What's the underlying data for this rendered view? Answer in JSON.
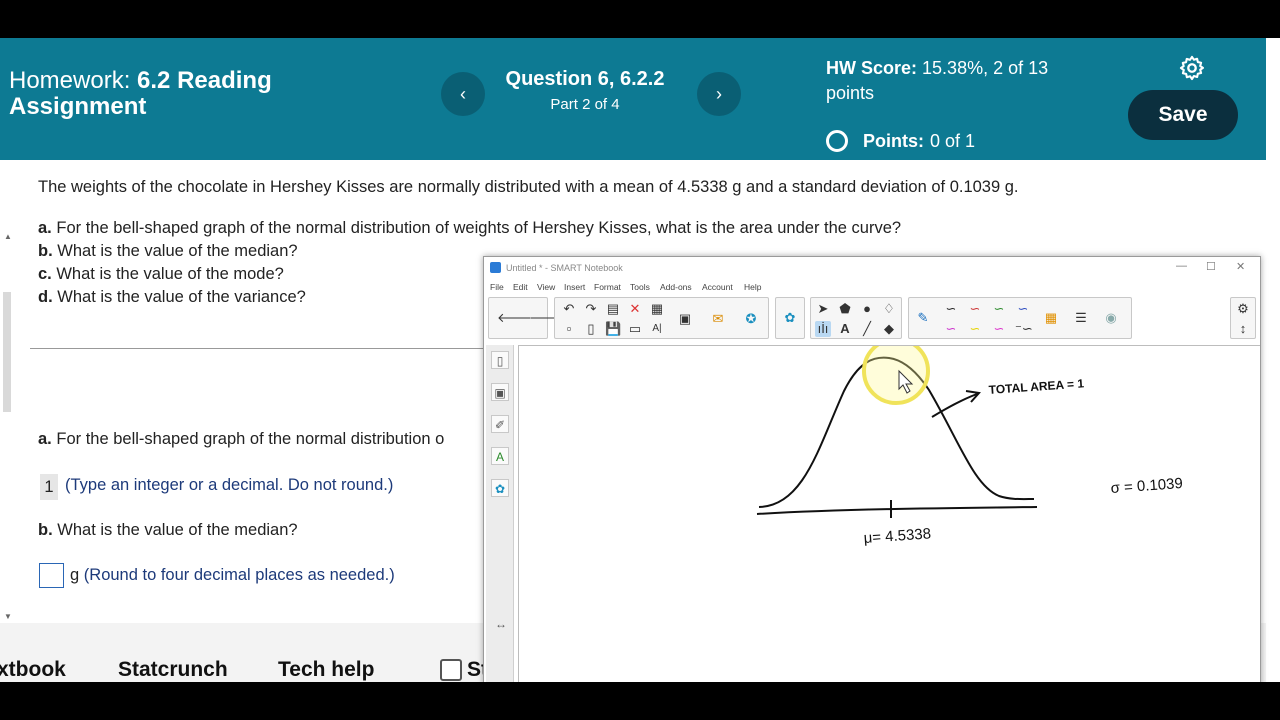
{
  "header": {
    "homework_prefix": "Homework:",
    "homework_name": "6.2 Reading Assignment",
    "question_title": "Question 6, 6.2.2",
    "question_part": "Part 2 of 4",
    "prev_icon": "‹",
    "next_icon": "›",
    "hw_score_label": "HW Score:",
    "hw_score_value": "15.38%, 2 of 13",
    "hw_score_suffix": "points",
    "points_label": "Points:",
    "points_value": "0 of 1",
    "save_label": "Save",
    "bg_color": "#0d7a93"
  },
  "question": {
    "intro": "The weights of the chocolate in Hershey Kisses are normally distributed with a mean of 4.5338 g and a standard deviation of 0.1039 g.",
    "parts": [
      {
        "letter": "a.",
        "text": "For the bell-shaped graph of the normal distribution of weights of Hershey Kisses, what is the area under the curve?"
      },
      {
        "letter": "b.",
        "text": "What is the value of the median?"
      },
      {
        "letter": "c.",
        "text": "What is the value of the mode?"
      },
      {
        "letter": "d.",
        "text": "What is the value of the variance?"
      }
    ]
  },
  "answers": {
    "a_prompt_letter": "a.",
    "a_prompt_text": "For the bell-shaped graph of the normal distribution o",
    "a_value": "1",
    "a_hint": "(Type an integer or a decimal. Do not round.)",
    "b_prompt_letter": "b.",
    "b_prompt_text": "What is the value of the median?",
    "b_value": "",
    "b_unit": "g",
    "b_hint": "(Round to four decimal places as needed.)"
  },
  "bottom_bar": {
    "textbook": "xtbook",
    "statcrunch": "Statcrunch",
    "techhelp": "Tech help",
    "checkbox_label": "St"
  },
  "notebook": {
    "title": "Untitled * - SMART Notebook",
    "menu": [
      "File",
      "Edit",
      "View",
      "Insert",
      "Format",
      "Tools",
      "Add-ons",
      "Account",
      "Help"
    ],
    "annotations": {
      "total_area": "TOTAL AREA = 1",
      "sigma": "σ = 0.1039",
      "mu": "μ= 4.5338"
    }
  }
}
